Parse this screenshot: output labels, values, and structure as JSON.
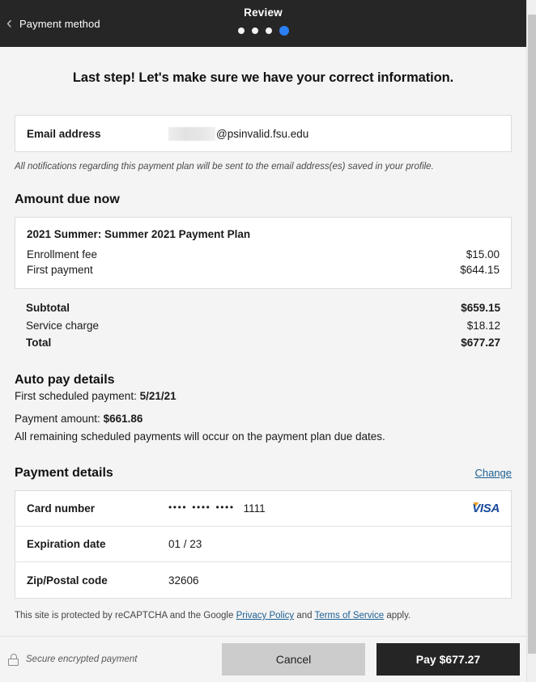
{
  "header": {
    "back_label": "Payment method",
    "back_icon": "chevron-left-icon",
    "step_title": "Review",
    "steps_total": 4,
    "active_step": 4,
    "background": "#262626",
    "active_dot_color": "#2b7ff5"
  },
  "page_title": "Last step! Let's make sure we have your correct information.",
  "email": {
    "label": "Email address",
    "redacted_user": "",
    "domain": "@psinvalid.fsu.edu",
    "note": "All notifications regarding this payment plan will be sent to the email address(es) saved in your profile."
  },
  "amount_due": {
    "heading": "Amount due now",
    "plan_name": "2021 Summer: Summer 2021 Payment Plan",
    "items": [
      {
        "label": "Enrollment fee",
        "value": "$15.00"
      },
      {
        "label": "First payment",
        "value": "$644.15"
      }
    ],
    "totals": [
      {
        "label": "Subtotal",
        "value": "$659.15",
        "bold": true
      },
      {
        "label": "Service charge",
        "value": "$18.12",
        "bold": false
      },
      {
        "label": "Total",
        "value": "$677.27",
        "bold": true
      }
    ]
  },
  "auto_pay": {
    "heading": "Auto pay details",
    "first_payment_label": "First scheduled payment: ",
    "first_payment_date": "5/21/21",
    "amount_label": "Payment amount: ",
    "amount_value": "$661.86",
    "remaining_note": "All remaining scheduled payments will occur on the payment plan due dates."
  },
  "payment_details": {
    "heading": "Payment details",
    "change_label": "Change",
    "change_color": "#1d5f92",
    "rows": [
      {
        "label": "Card number",
        "value": "1111",
        "masked": true,
        "brand": "VISA"
      },
      {
        "label": "Expiration date",
        "value": "01 / 23",
        "masked": false,
        "brand": ""
      },
      {
        "label": "Zip/Postal code",
        "value": "32606",
        "masked": false,
        "brand": ""
      }
    ]
  },
  "recaptcha": {
    "prefix": "This site is protected by reCAPTCHA and the Google ",
    "privacy_link": "Privacy Policy",
    "middle": " and ",
    "terms_link": "Terms of Service",
    "suffix": " apply."
  },
  "footer": {
    "secure_icon": "lock-icon",
    "secure_text": "Secure encrypted payment",
    "cancel_label": "Cancel",
    "pay_label": "Pay $677.27",
    "pay_button_color": "#252525",
    "cancel_button_color": "#cccccc"
  }
}
